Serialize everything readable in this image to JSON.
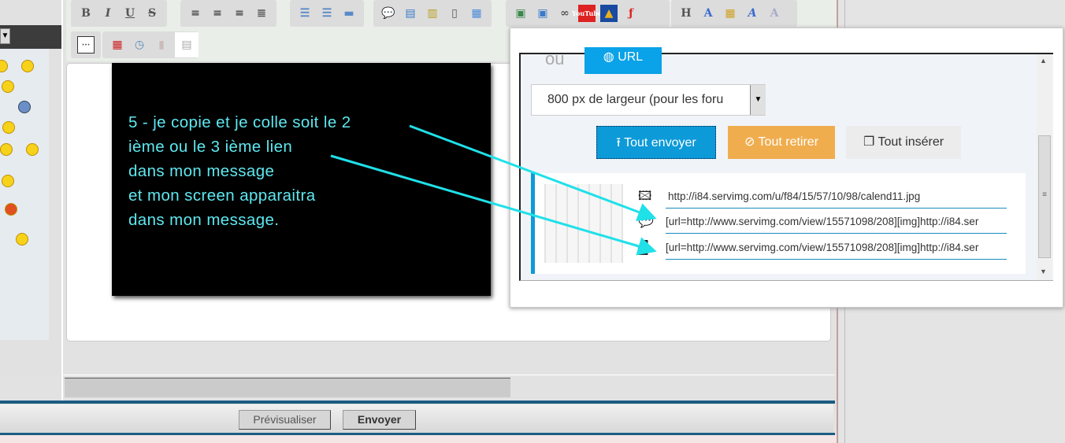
{
  "toolbar": {
    "row1": [
      "B",
      "I",
      "U",
      "S",
      "align-left",
      "align-center",
      "align-right",
      "justify",
      "bullet-list",
      "numbered-list",
      "hr",
      "quote",
      "code",
      "spoiler",
      "hide",
      "table",
      "image",
      "image-upload",
      "link",
      "YouTube",
      "flash",
      "dailymotion",
      "H",
      "font-size",
      "color",
      "font",
      "clear-format"
    ],
    "row2": [
      "more",
      "calendar",
      "clock",
      "paste",
      "source"
    ]
  },
  "annotation": {
    "lines": [
      "5 - je copie et je colle soit le 2",
      "ième ou le 3 ième lien",
      "dans mon message",
      "et mon screen apparaitra",
      "dans mon message."
    ],
    "color": "#5ee8f0"
  },
  "upload": {
    "or_label": "ou",
    "url_tab": "URL",
    "size_select": "800 px de largeur (pour les foru",
    "send_all": "Tout envoyer",
    "remove_all": "Tout retirer",
    "insert_all": "Tout insérer",
    "links": [
      "http://i84.servimg.com/u/f84/15/57/10/98/calend11.jpg",
      "[url=http://www.servimg.com/view/15571098/208][img]http://i84.ser",
      "[url=http://www.servimg.com/view/15571098/208][img]http://i84.ser"
    ]
  },
  "form": {
    "preview": "Prévisualiser",
    "send": "Envoyer"
  }
}
